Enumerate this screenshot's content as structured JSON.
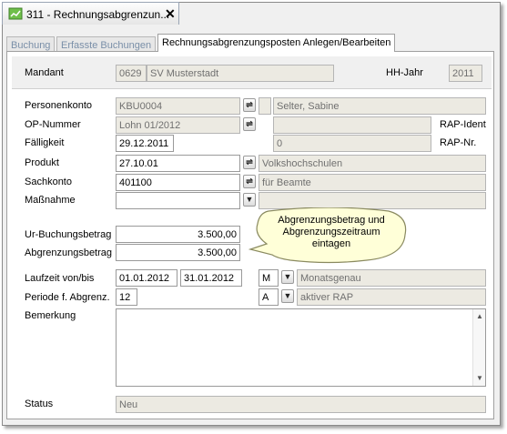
{
  "document_tab": {
    "title": "311 - Rechnungsabgrenzun...",
    "close": "✕"
  },
  "inner_tabs": [
    {
      "label": "Buchung"
    },
    {
      "label": "Erfasste Buchungen"
    },
    {
      "label": "Rechnungsabgrenzungsposten Anlegen/Bearbeiten"
    }
  ],
  "header": {
    "mandant_label": "Mandant",
    "mandant_code": "0629",
    "mandant_name": "SV Musterstadt",
    "hhjahr_label": "HH-Jahr",
    "hhjahr_value": "2011"
  },
  "form": {
    "personenkonto_label": "Personenkonto",
    "personenkonto_value": "KBU0004",
    "personenkonto_name": "Selter, Sabine",
    "opnummer_label": "OP-Nummer",
    "opnummer_value": "Lohn 01/2012",
    "rap_ident_label": "RAP-Ident",
    "rap_ident_value": "",
    "faelligkeit_label": "Fälligkeit",
    "faelligkeit_value": "29.12.2011",
    "rap_nr_label": "RAP-Nr.",
    "rap_nr_value": "0",
    "produkt_label": "Produkt",
    "produkt_value": "27.10.01",
    "produkt_name": "Volkshochschulen",
    "sachkonto_label": "Sachkonto",
    "sachkonto_value": "401100",
    "sachkonto_name": "für Beamte",
    "massnahme_label": "Maßnahme",
    "massnahme_value": "",
    "massnahme_name": "",
    "ur_buchungsbetrag_label": "Ur-Buchungsbetrag",
    "ur_buchungsbetrag_value": "3.500,00",
    "abgrenzungsbetrag_label": "Abgrenzungsbetrag",
    "abgrenzungsbetrag_value": "3.500,00",
    "laufzeit_label": "Laufzeit von/bis",
    "laufzeit_von": "01.01.2012",
    "laufzeit_bis": "31.01.2012",
    "laufzeit_code": "M",
    "laufzeit_desc": "Monatsgenau",
    "periode_label": "Periode f. Abgrenz.",
    "periode_value": "12",
    "periode_code": "A",
    "periode_desc": "aktiver RAP",
    "bemerkung_label": "Bemerkung",
    "bemerkung_value": "",
    "status_label": "Status",
    "status_value": "Neu"
  },
  "callout": {
    "text_line1": "Abgrenzungsbetrag und",
    "text_line2": "Abgrenzungszeitraum",
    "text_line3": "eintagen"
  },
  "icons": {
    "lookup": "lookup-icon",
    "dropdown": "dropdown-icon"
  },
  "colors": {
    "readonly_bg": "#eceae2",
    "callout_fill": "#ffffd8",
    "tab_inactive_text": "#7a8fa8"
  }
}
